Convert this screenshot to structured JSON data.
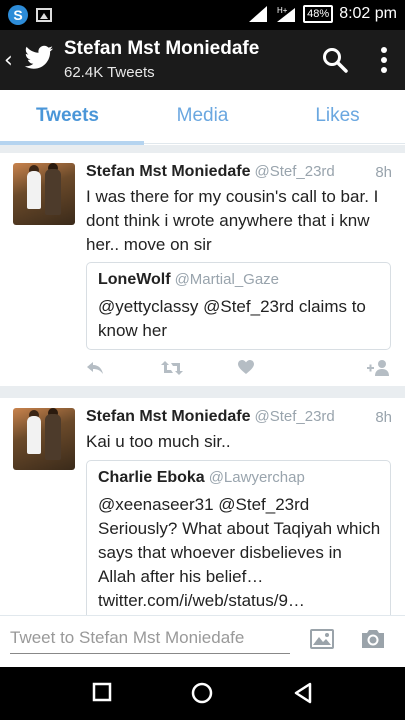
{
  "status_bar": {
    "time": "8:02 pm",
    "battery": "48%",
    "network": "H+"
  },
  "header": {
    "title": "Stefan Mst Moniedafe",
    "subtitle": "62.4K Tweets"
  },
  "tabs": [
    {
      "label": "Tweets",
      "active": true
    },
    {
      "label": "Media",
      "active": false
    },
    {
      "label": "Likes",
      "active": false
    }
  ],
  "tweets": [
    {
      "name": "Stefan Mst Moniedafe",
      "handle": "@Stef_23rd",
      "time": "8h",
      "text": "I was there for my cousin's call to bar. I dont think i wrote anywhere that i knw her.. move on sir",
      "quote": {
        "name": "LoneWolf",
        "handle": "@Martial_Gaze",
        "text": "@yettyclassy @Stef_23rd claims to know her"
      }
    },
    {
      "name": "Stefan Mst Moniedafe",
      "handle": "@Stef_23rd",
      "time": "8h",
      "text": "Kai u too much sir..",
      "quote": {
        "name": "Charlie Eboka",
        "handle": "@Lawyerchap",
        "text": "@xeenaseer31 @Stef_23rd Seriously? What about Taqiyah which says that whoever disbelieves in Allah after his belief… twitter.com/i/web/status/9…"
      }
    }
  ],
  "compose": {
    "placeholder": "Tweet to Stefan Mst Moniedafe"
  },
  "colors": {
    "accent": "#4a96d8",
    "appbar": "#1b1b1b",
    "muted": "#99a4ad"
  }
}
